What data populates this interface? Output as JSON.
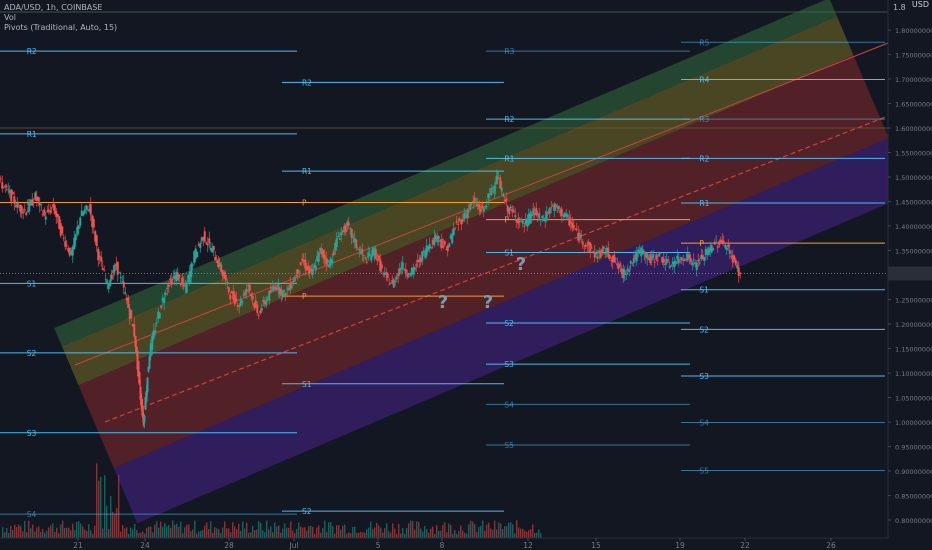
{
  "header": {
    "symbol": "ADA/USD, 1h, COINBASE",
    "indicator_vol": "Vol",
    "indicator_pivots": "Pivots (Traditional, Auto, 15)",
    "currency": "USD"
  },
  "colors": {
    "background": "#131722",
    "candle_up": "#26a69a",
    "candle_down": "#ef5350",
    "pivot_resistance": "#4fc3f7",
    "pivot_p": "#ffa726",
    "pivot_support": "#4fc3f7",
    "text": "#787b86",
    "band_green": "rgba(76,175,80,0.30)",
    "band_yellow": "rgba(200,180,40,0.30)",
    "band_red": "rgba(200,50,50,0.35)",
    "band_purple": "rgba(100,40,200,0.35)",
    "question": "#7a9aae"
  },
  "chart_data": {
    "type": "candlestick",
    "y_axis": {
      "range": [
        0.785,
        1.84
      ],
      "ticks": [
        "1.80000000",
        "1.75000000",
        "1.70000000",
        "1.65000000",
        "1.60000000",
        "1.55000000",
        "1.50000000",
        "1.45000000",
        "1.40000000",
        "1.35000000",
        "1.30000000",
        "1.25000000",
        "1.20000000",
        "1.15000000",
        "1.10000000",
        "1.05000000",
        "1.00000000",
        "0.95000000",
        "0.90000000",
        "0.85000000",
        "0.80000000"
      ],
      "tick_values": [
        1.8,
        1.75,
        1.7,
        1.65,
        1.6,
        1.55,
        1.5,
        1.45,
        1.4,
        1.35,
        1.3,
        1.25,
        1.2,
        1.15,
        1.1,
        1.05,
        1.0,
        0.95,
        0.9,
        0.85,
        0.8
      ],
      "top_label": "1.8"
    },
    "x_axis": {
      "range": [
        0,
        29.5
      ],
      "labels": [
        "21",
        "24",
        "28",
        "Jul",
        "5",
        "8",
        "12",
        "15",
        "19",
        "22",
        "26"
      ],
      "label_positions": [
        3.4,
        6.2,
        10.0,
        13.0,
        16.7,
        19.7,
        23.6,
        26.5,
        30.3,
        33.3,
        37.2
      ],
      "note": "x in approx days from start of visible period"
    },
    "current_price": 1.303,
    "price_path": [
      [
        0,
        1.49
      ],
      [
        0.3,
        1.47
      ],
      [
        0.6,
        1.44
      ],
      [
        0.9,
        1.43
      ],
      [
        1.2,
        1.46
      ],
      [
        1.5,
        1.42
      ],
      [
        1.8,
        1.44
      ],
      [
        2.1,
        1.38
      ],
      [
        2.4,
        1.34
      ],
      [
        2.7,
        1.42
      ],
      [
        3.0,
        1.44
      ],
      [
        3.3,
        1.34
      ],
      [
        3.6,
        1.28
      ],
      [
        3.9,
        1.32
      ],
      [
        4.2,
        1.26
      ],
      [
        4.5,
        1.18
      ],
      [
        4.7,
        1.05
      ],
      [
        4.8,
        1.0
      ],
      [
        5.0,
        1.14
      ],
      [
        5.3,
        1.22
      ],
      [
        5.6,
        1.28
      ],
      [
        5.9,
        1.3
      ],
      [
        6.2,
        1.27
      ],
      [
        6.5,
        1.34
      ],
      [
        6.8,
        1.38
      ],
      [
        7.1,
        1.35
      ],
      [
        7.4,
        1.31
      ],
      [
        7.7,
        1.26
      ],
      [
        8.0,
        1.24
      ],
      [
        8.3,
        1.28
      ],
      [
        8.6,
        1.22
      ],
      [
        8.9,
        1.25
      ],
      [
        9.2,
        1.28
      ],
      [
        9.5,
        1.26
      ],
      [
        9.8,
        1.29
      ],
      [
        10.1,
        1.33
      ],
      [
        10.4,
        1.3
      ],
      [
        10.7,
        1.35
      ],
      [
        11.0,
        1.32
      ],
      [
        11.3,
        1.38
      ],
      [
        11.6,
        1.4
      ],
      [
        11.9,
        1.36
      ],
      [
        12.2,
        1.33
      ],
      [
        12.5,
        1.35
      ],
      [
        12.8,
        1.3
      ],
      [
        13.1,
        1.28
      ],
      [
        13.4,
        1.32
      ],
      [
        13.7,
        1.3
      ],
      [
        14.0,
        1.33
      ],
      [
        14.3,
        1.36
      ],
      [
        14.6,
        1.38
      ],
      [
        14.9,
        1.35
      ],
      [
        15.2,
        1.4
      ],
      [
        15.5,
        1.42
      ],
      [
        15.8,
        1.45
      ],
      [
        16.1,
        1.43
      ],
      [
        16.4,
        1.47
      ],
      [
        16.6,
        1.5
      ],
      [
        16.9,
        1.44
      ],
      [
        17.2,
        1.42
      ],
      [
        17.5,
        1.4
      ],
      [
        17.8,
        1.43
      ],
      [
        18.1,
        1.41
      ],
      [
        18.4,
        1.44
      ],
      [
        18.7,
        1.43
      ],
      [
        19.0,
        1.41
      ],
      [
        19.3,
        1.38
      ],
      [
        19.6,
        1.36
      ],
      [
        19.9,
        1.34
      ],
      [
        20.2,
        1.35
      ],
      [
        20.5,
        1.33
      ],
      [
        20.8,
        1.3
      ],
      [
        21.1,
        1.33
      ],
      [
        21.4,
        1.35
      ],
      [
        21.7,
        1.33
      ],
      [
        22.0,
        1.34
      ],
      [
        22.3,
        1.32
      ],
      [
        22.6,
        1.33
      ],
      [
        22.9,
        1.34
      ],
      [
        23.2,
        1.32
      ],
      [
        23.5,
        1.34
      ],
      [
        23.8,
        1.36
      ],
      [
        24.1,
        1.37
      ],
      [
        24.4,
        1.34
      ],
      [
        24.7,
        1.3
      ]
    ],
    "pivot_sets": [
      {
        "x0": 0,
        "x1": 9.9,
        "levels": [
          {
            "label": "R2",
            "value": 1.757,
            "kind": "R"
          },
          {
            "label": "R1",
            "value": 1.588,
            "kind": "R"
          },
          {
            "label": "P",
            "value": 1.448,
            "kind": "P"
          },
          {
            "label": "S1",
            "value": 1.283,
            "kind": "S"
          },
          {
            "label": "S2",
            "value": 1.141,
            "kind": "S"
          },
          {
            "label": "S3",
            "value": 0.978,
            "kind": "S"
          },
          {
            "label": "S4",
            "value": 0.812,
            "kind": "S"
          }
        ]
      },
      {
        "x0": 9.4,
        "x1": 16.8,
        "levels": [
          {
            "label": "R2",
            "value": 1.693,
            "kind": "R"
          },
          {
            "label": "R1",
            "value": 1.512,
            "kind": "R"
          },
          {
            "label": "P",
            "value": 1.448,
            "kind": "P"
          },
          {
            "label": "P",
            "value": 1.257,
            "kind": "P"
          },
          {
            "label": "S1",
            "value": 1.078,
            "kind": "S"
          },
          {
            "label": "S2",
            "value": 0.818,
            "kind": "S"
          }
        ]
      },
      {
        "x0": 16.2,
        "x1": 23.0,
        "levels": [
          {
            "label": "R3",
            "value": 1.757,
            "kind": "R"
          },
          {
            "label": "R2",
            "value": 1.618,
            "kind": "R"
          },
          {
            "label": "R1",
            "value": 1.538,
            "kind": "R"
          },
          {
            "label": "P",
            "value": 1.413,
            "kind": "P"
          },
          {
            "label": "S1",
            "value": 1.346,
            "kind": "S"
          },
          {
            "label": "S2",
            "value": 1.202,
            "kind": "S"
          },
          {
            "label": "S3",
            "value": 1.118,
            "kind": "S"
          },
          {
            "label": "S4",
            "value": 1.036,
            "kind": "S"
          },
          {
            "label": "S5",
            "value": 0.953,
            "kind": "S"
          }
        ]
      },
      {
        "x0": 22.7,
        "x1": 29.5,
        "levels": [
          {
            "label": "R5",
            "value": 1.775,
            "kind": "R"
          },
          {
            "label": "R4",
            "value": 1.699,
            "kind": "R"
          },
          {
            "label": "R3",
            "value": 1.618,
            "kind": "R"
          },
          {
            "label": "R2",
            "value": 1.538,
            "kind": "R"
          },
          {
            "label": "R1",
            "value": 1.447,
            "kind": "R"
          },
          {
            "label": "P",
            "value": 1.365,
            "kind": "P"
          },
          {
            "label": "S1",
            "value": 1.27,
            "kind": "S"
          },
          {
            "label": "S2",
            "value": 1.189,
            "kind": "S"
          },
          {
            "label": "S3",
            "value": 1.094,
            "kind": "S"
          },
          {
            "label": "S4",
            "value": 0.999,
            "kind": "S"
          },
          {
            "label": "S5",
            "value": 0.901,
            "kind": "S"
          }
        ]
      }
    ],
    "annotations": [
      "?",
      "?",
      "?"
    ]
  }
}
